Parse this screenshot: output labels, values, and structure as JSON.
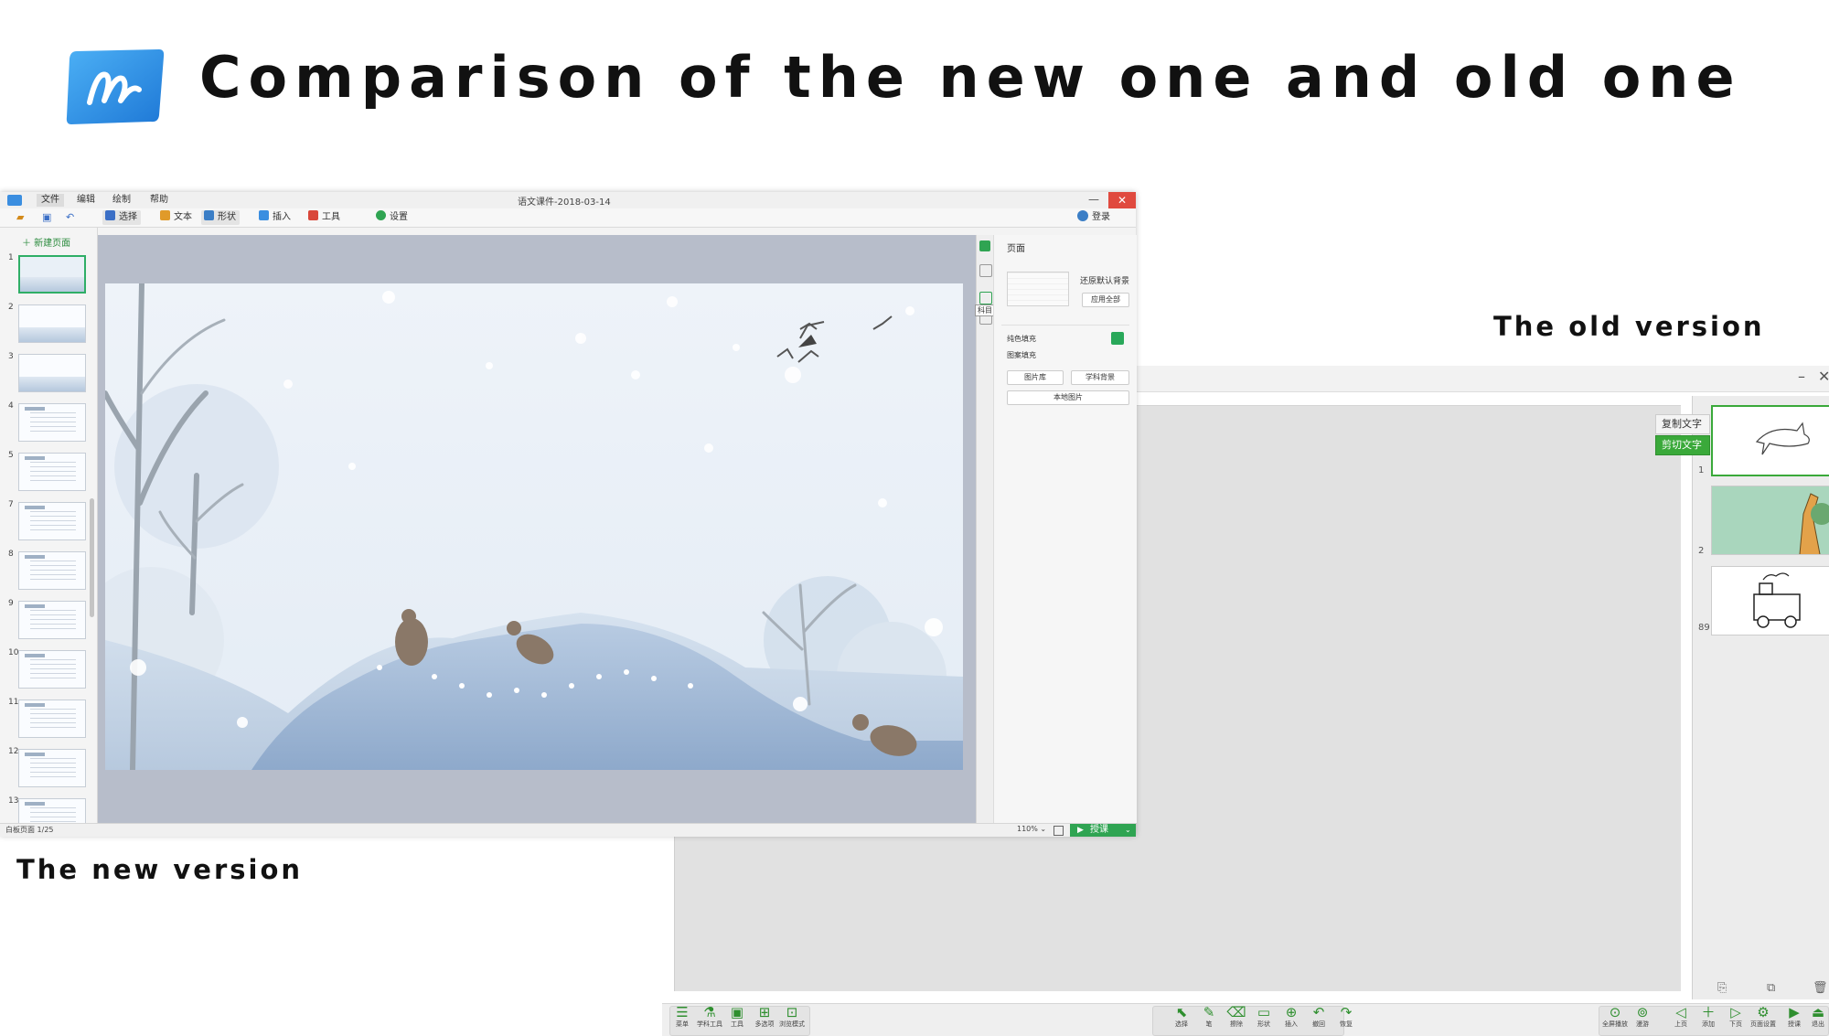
{
  "title": "Comparison of the new one and old one",
  "labels": {
    "old_version": "The old version",
    "new_version": "The new version"
  },
  "colors": {
    "accent_green": "#2fa452",
    "close_red": "#e04a3f",
    "logo_blue": "#2e8fe0",
    "selected_border": "#3aa93a"
  },
  "new_app": {
    "menu": [
      "文件",
      "编辑",
      "绘制",
      "帮助"
    ],
    "doc_title": "语文课件-2018-03-14",
    "window_controls": {
      "minimize": "—",
      "close": "✕"
    },
    "toolbar": [
      {
        "label": "选择",
        "icon": "cursor-icon",
        "color": "#3b6fc6"
      },
      {
        "label": "文本",
        "icon": "text-icon",
        "color": "#e09a2a"
      },
      {
        "label": "形状",
        "icon": "shape-icon",
        "color": "#3b7ec6"
      },
      {
        "label": "插入",
        "icon": "insert-icon",
        "color": "#3b8ee0"
      },
      {
        "label": "工具",
        "icon": "toolbox-icon",
        "color": "#d9473a"
      },
      {
        "label": "设置",
        "icon": "gear-icon",
        "color": "#2fa452"
      }
    ],
    "login": "登录",
    "new_page": "＋ 新建页面",
    "slide_numbers": [
      "1",
      "2",
      "3",
      "4",
      "5",
      "7",
      "8",
      "9",
      "10",
      "11",
      "12",
      "13"
    ],
    "right_panel": {
      "title": "页面",
      "restore_default": "还原默认背景",
      "apply_all": "应用全部",
      "solid_fill": "纯色填充",
      "pattern_fill": "图案填充",
      "image_library": "图片库",
      "subject_background": "学科背景",
      "local_image": "本地图片"
    },
    "tooltip": "科目",
    "status_page": "白板页面 1/25",
    "zoom": "110% ⌄",
    "present_label": "授课"
  },
  "old_app": {
    "window_controls": {
      "minimize": "–",
      "close": "✕"
    },
    "context_menu": [
      "复制文字",
      "剪切文字"
    ],
    "thumbnails": [
      "1",
      "2",
      "89"
    ],
    "toolbar": [
      {
        "label": "菜单",
        "glyph": "☰"
      },
      {
        "label": "学科工具",
        "glyph": "⚗"
      },
      {
        "label": "工具",
        "glyph": "▣"
      },
      {
        "label": "多选项",
        "glyph": "⊞"
      },
      {
        "label": "浏览模式",
        "glyph": "⊡"
      },
      {
        "label": "选择",
        "glyph": "⬉"
      },
      {
        "label": "笔",
        "glyph": "✎"
      },
      {
        "label": "擦除",
        "glyph": "⌫"
      },
      {
        "label": "形状",
        "glyph": "▭"
      },
      {
        "label": "插入",
        "glyph": "⊕"
      },
      {
        "label": "撤回",
        "glyph": "↶"
      },
      {
        "label": "恢复",
        "glyph": "↷"
      },
      {
        "label": "全屏播放",
        "glyph": "⊙"
      },
      {
        "label": "漫游",
        "glyph": "⊚"
      },
      {
        "label": "上页",
        "glyph": "◁"
      },
      {
        "label": "添加",
        "glyph": "＋"
      },
      {
        "label": "下页",
        "glyph": "▷"
      },
      {
        "label": "页面设置",
        "glyph": "⚙"
      },
      {
        "label": "授课",
        "glyph": "▶"
      },
      {
        "label": "退出",
        "glyph": "⏏"
      }
    ]
  }
}
